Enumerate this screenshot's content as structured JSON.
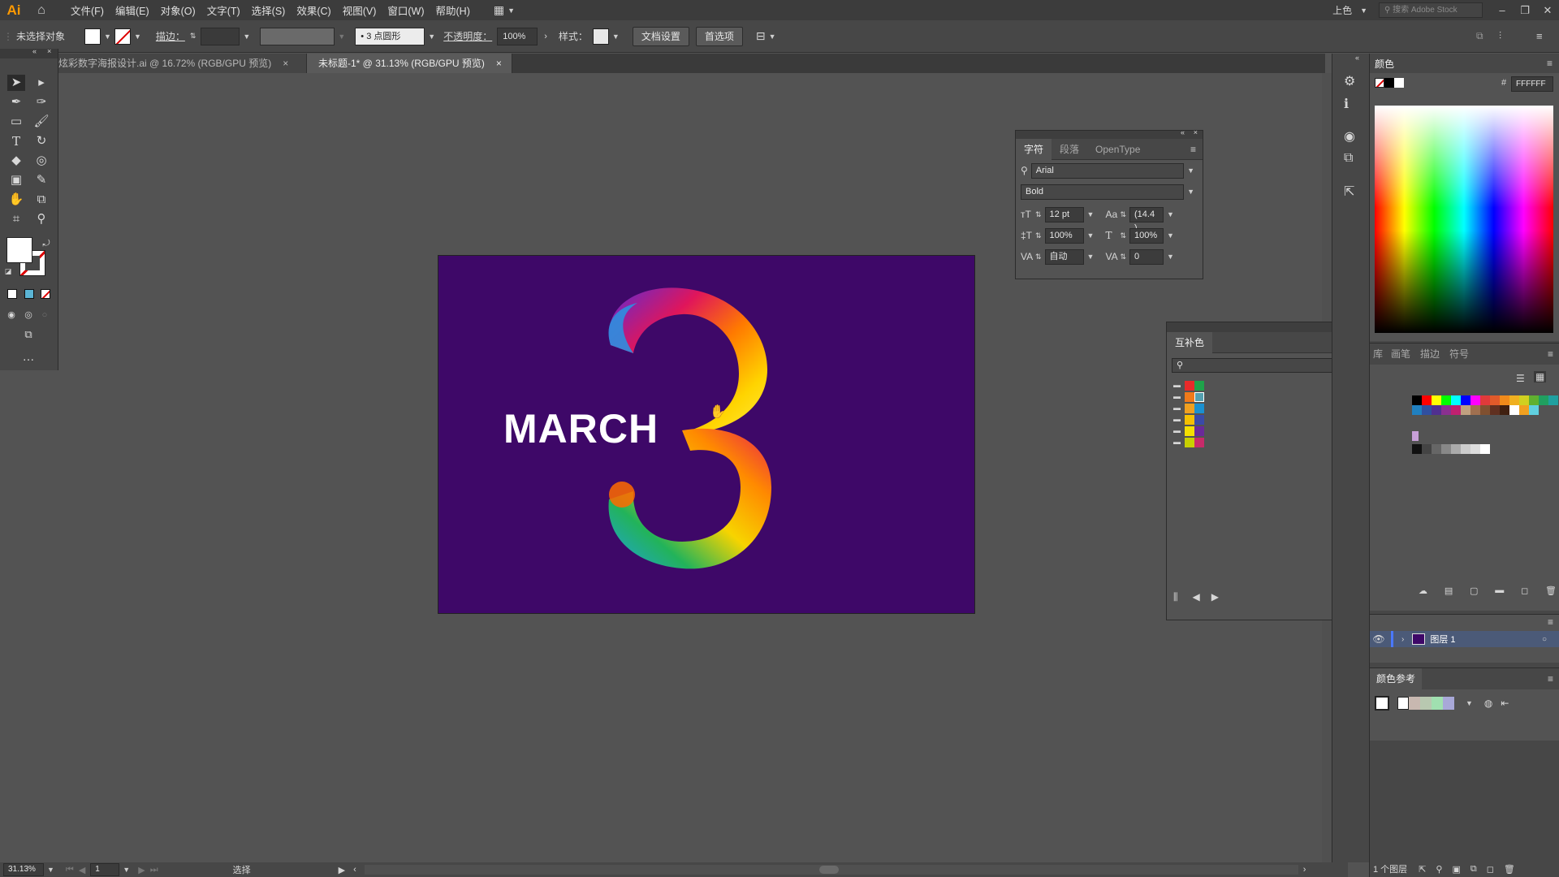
{
  "app": {
    "logo": "Ai",
    "menu": [
      "文件(F)",
      "编辑(E)",
      "对象(O)",
      "文字(T)",
      "选择(S)",
      "效果(C)",
      "视图(V)",
      "窗口(W)",
      "帮助(H)"
    ],
    "workspace": "上色",
    "stock_search_placeholder": "搜索 Adobe Stock"
  },
  "control_bar": {
    "selection_label": "未选择对象",
    "stroke_label": "描边：",
    "brush_value": "3 点圆形",
    "opacity_label": "不透明度：",
    "opacity_value": "100%",
    "style_label": "样式：",
    "doc_setup_button": "文档设置",
    "prefs_button": "首选项"
  },
  "tabs": [
    {
      "label": "炫彩数字海报设计.ai @ 16.72% (RGB/GPU 预览)",
      "close": "×",
      "active": false
    },
    {
      "label": "未标题-1* @ 31.13% (RGB/GPU 预览)",
      "close": "×",
      "active": true
    }
  ],
  "artwork": {
    "text": "MARCH",
    "accent_bg": "#3e0868"
  },
  "character_panel": {
    "tabs": [
      "字符",
      "段落",
      "OpenType"
    ],
    "font_family": "Arial",
    "font_style": "Bold",
    "font_size": "12 pt",
    "leading": "(14.4 )",
    "vertical_scale": "100%",
    "horizontal_scale": "100%",
    "kerning": "自动",
    "tracking": "0"
  },
  "color_panel": {
    "title": "颜色",
    "hex_label": "#",
    "hex_value": "FFFFFF"
  },
  "harmony_panel": {
    "title": "互补色"
  },
  "library_panel": {
    "tabs": [
      "库",
      "画笔",
      "描边",
      "符号"
    ]
  },
  "layers_panel": {
    "layer_name": "图层 1",
    "count_label": "1 个图层"
  },
  "color_guide_panel": {
    "title": "颜色参考"
  },
  "status": {
    "zoom": "31.13%",
    "artboard_number": "1",
    "tool_label": "选择"
  }
}
